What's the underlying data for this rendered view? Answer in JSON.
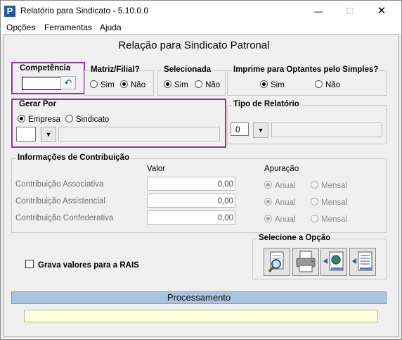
{
  "window": {
    "title": "Relatório para Sindicato - 5.10.0.0",
    "icon": "P",
    "minimize": "—",
    "maximize": "☐",
    "close": "✕"
  },
  "menu": [
    "Opções",
    "Ferramentas",
    "Ajuda"
  ],
  "header": "Relação para Sindicato Patronal",
  "competencia": {
    "label": "Competência",
    "value": "",
    "reset_icon": "↶"
  },
  "matriz": {
    "label": "Matriz/Filial?",
    "sim": "Sim",
    "nao": "Não",
    "selected": "Não"
  },
  "selecionada": {
    "label": "Selecionada",
    "sim": "Sim",
    "nao": "Não",
    "selected": "Sim"
  },
  "optantes": {
    "label": "Imprime para Optantes pelo Simples?",
    "sim": "Sim",
    "nao": "Não",
    "selected": "Sim"
  },
  "gerar": {
    "label": "Gerar Por",
    "empresa": "Empresa",
    "sindicato": "Sindicato",
    "selected": "Empresa",
    "code": "",
    "desc": ""
  },
  "tipo": {
    "label": "Tipo de Relatório",
    "value": "0",
    "desc": ""
  },
  "contrib": {
    "label": "Informações de Contribuição",
    "col_valor": "Valor",
    "col_apuracao": "Apuração",
    "rows": [
      {
        "label": "Contribuição Associativa",
        "valor": "0,00",
        "anual": "Anual",
        "mensal": "Mensal"
      },
      {
        "label": "Contribuição Assistencial",
        "valor": "0,00",
        "anual": "Anual",
        "mensal": "Mensal"
      },
      {
        "label": "Contribuição Confederativa",
        "valor": "0,00",
        "anual": "Anual",
        "mensal": "Mensal"
      }
    ]
  },
  "rais": {
    "label": "Grava valores para a RAIS",
    "checked": false
  },
  "opcao": {
    "label": "Selecione a Opção",
    "tools": [
      "preview-icon",
      "printer-icon",
      "export-web-icon",
      "export-document-icon"
    ]
  },
  "processamento": {
    "label": "Processamento",
    "status": ""
  }
}
